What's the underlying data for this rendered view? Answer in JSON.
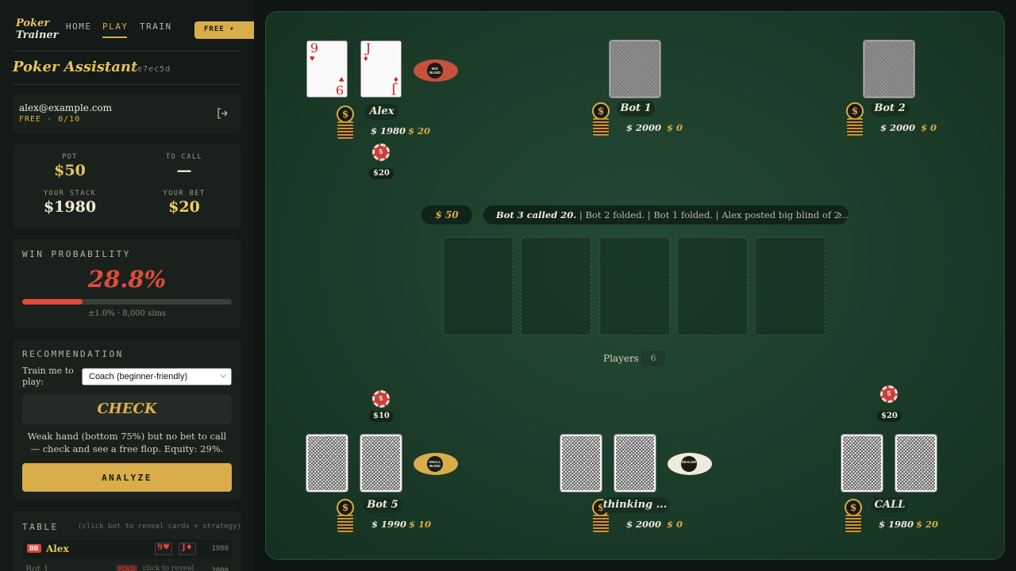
{
  "nav": {
    "logo_line1": "Poker",
    "logo_line2": "Trainer",
    "links": [
      "HOME",
      "PLAY",
      "TRAIN"
    ],
    "active": "PLAY",
    "plan_button": "FREE ▾"
  },
  "header": {
    "title": "Poker Assistant",
    "session_id": "fe7ec5d"
  },
  "user": {
    "email": "alex@example.com",
    "plan": "FREE · 0/10",
    "logout_icon": "logout-icon"
  },
  "stats": {
    "pot_label": "POT",
    "pot_value": "$50",
    "to_call_label": "TO CALL",
    "to_call_value": "—",
    "stack_label": "YOUR STACK",
    "stack_value": "$1980",
    "bet_label": "YOUR BET",
    "bet_value": "$20"
  },
  "win": {
    "label": "WIN PROBABILITY",
    "value": "28.8%",
    "fraction": 0.288,
    "meta": "±1.0% · 8,000 sims"
  },
  "recommendation": {
    "label": "RECOMMENDATION",
    "train_label": "Train me to play:",
    "mode": "Coach (beginner-friendly)",
    "action": "CHECK",
    "text": "Weak hand (bottom 75%) but no bet to call — check and see a free flop. Equity: 29%.",
    "analyze": "ANALYZE"
  },
  "table_panel": {
    "label": "TABLE",
    "hint": "(click bot to reveal cards + strategy)",
    "rows": [
      {
        "badge": "BB",
        "name": "Alex",
        "card1": "9♥",
        "card2": "J♦",
        "stack": "1980"
      },
      {
        "name": "Bot 1",
        "status": "FOLD",
        "hint": "click to reveal",
        "stack": "2000"
      }
    ]
  },
  "felt": {
    "pot": "$ 50",
    "log_first": "Bot 3 called 20.",
    "log_rest": " | Bot 2 folded. | Bot 1 folded. | Alex posted big blind of 2...",
    "players_label": "Players",
    "players_count": "6",
    "seats": [
      {
        "name": "Alex",
        "stack": "$ 1980",
        "bet": "$ 20",
        "chip_value": "5",
        "chip_label": "$20",
        "marker": "BIG BLIND",
        "card1_rank": "9",
        "card1_suit": "♥",
        "card2_rank": "J",
        "card2_suit": "♦"
      },
      {
        "name": "Bot 1",
        "stack": "$ 2000",
        "bet": "$ 0"
      },
      {
        "name": "Bot 2",
        "stack": "$ 2000",
        "bet": "$ 0"
      },
      {
        "name": "Bot 5",
        "stack": "$ 1990",
        "bet": "$ 10",
        "chip_value": "5",
        "chip_label": "$10",
        "marker": "SMALL BLIND"
      },
      {
        "name": "thinking ...",
        "stack": "$ 2000",
        "bet": "$ 0",
        "marker": "DEALER"
      },
      {
        "name": "CALL",
        "stack": "$ 1980",
        "bet": "$ 20",
        "chip_value": "5",
        "chip_label": "$20"
      }
    ]
  },
  "colors": {
    "accent": "#d9ad4a",
    "danger": "#e04a3c",
    "felt": "#1c3c2a"
  }
}
